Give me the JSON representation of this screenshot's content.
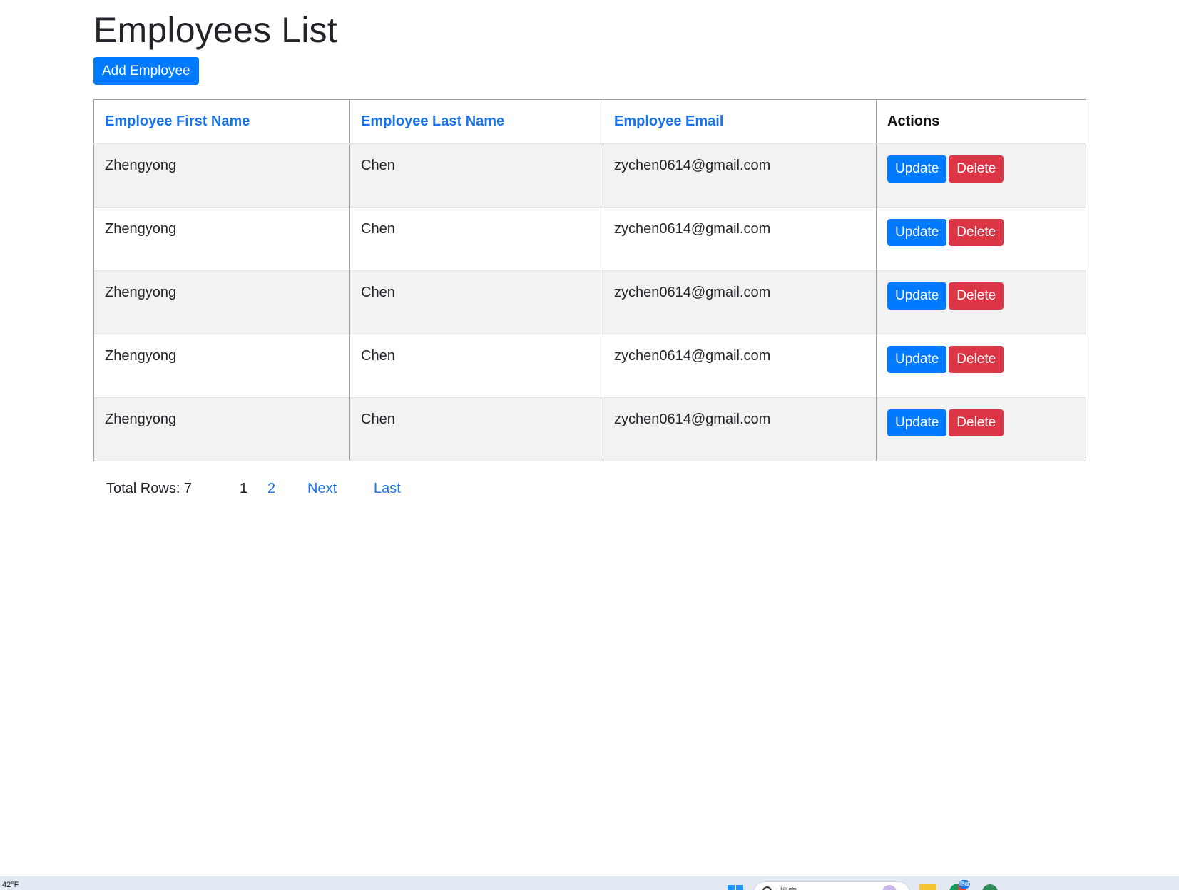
{
  "page": {
    "title": "Employees List",
    "add_button_label": "Add Employee"
  },
  "table": {
    "headers": {
      "first_name": "Employee First Name",
      "last_name": "Employee Last Name",
      "email": "Employee Email",
      "actions": "Actions"
    },
    "rows": [
      {
        "first_name": "Zhengyong",
        "last_name": "Chen",
        "email": "zychen0614@gmail.com"
      },
      {
        "first_name": "Zhengyong",
        "last_name": "Chen",
        "email": "zychen0614@gmail.com"
      },
      {
        "first_name": "Zhengyong",
        "last_name": "Chen",
        "email": "zychen0614@gmail.com"
      },
      {
        "first_name": "Zhengyong",
        "last_name": "Chen",
        "email": "zychen0614@gmail.com"
      },
      {
        "first_name": "Zhengyong",
        "last_name": "Chen",
        "email": "zychen0614@gmail.com"
      }
    ],
    "update_label": "Update",
    "delete_label": "Delete"
  },
  "pagination": {
    "total_rows": "Total Rows: 7",
    "current_page": "1",
    "page_2": "2",
    "next": "Next",
    "last": "Last"
  },
  "taskbar": {
    "weather": "42°F",
    "search_placeholder": "搜索",
    "chrome_badge": "隐藏"
  },
  "colors": {
    "primary": "#007bff",
    "danger": "#dc3545",
    "link": "#1a73e8",
    "striped_row": "#f2f2f2"
  }
}
